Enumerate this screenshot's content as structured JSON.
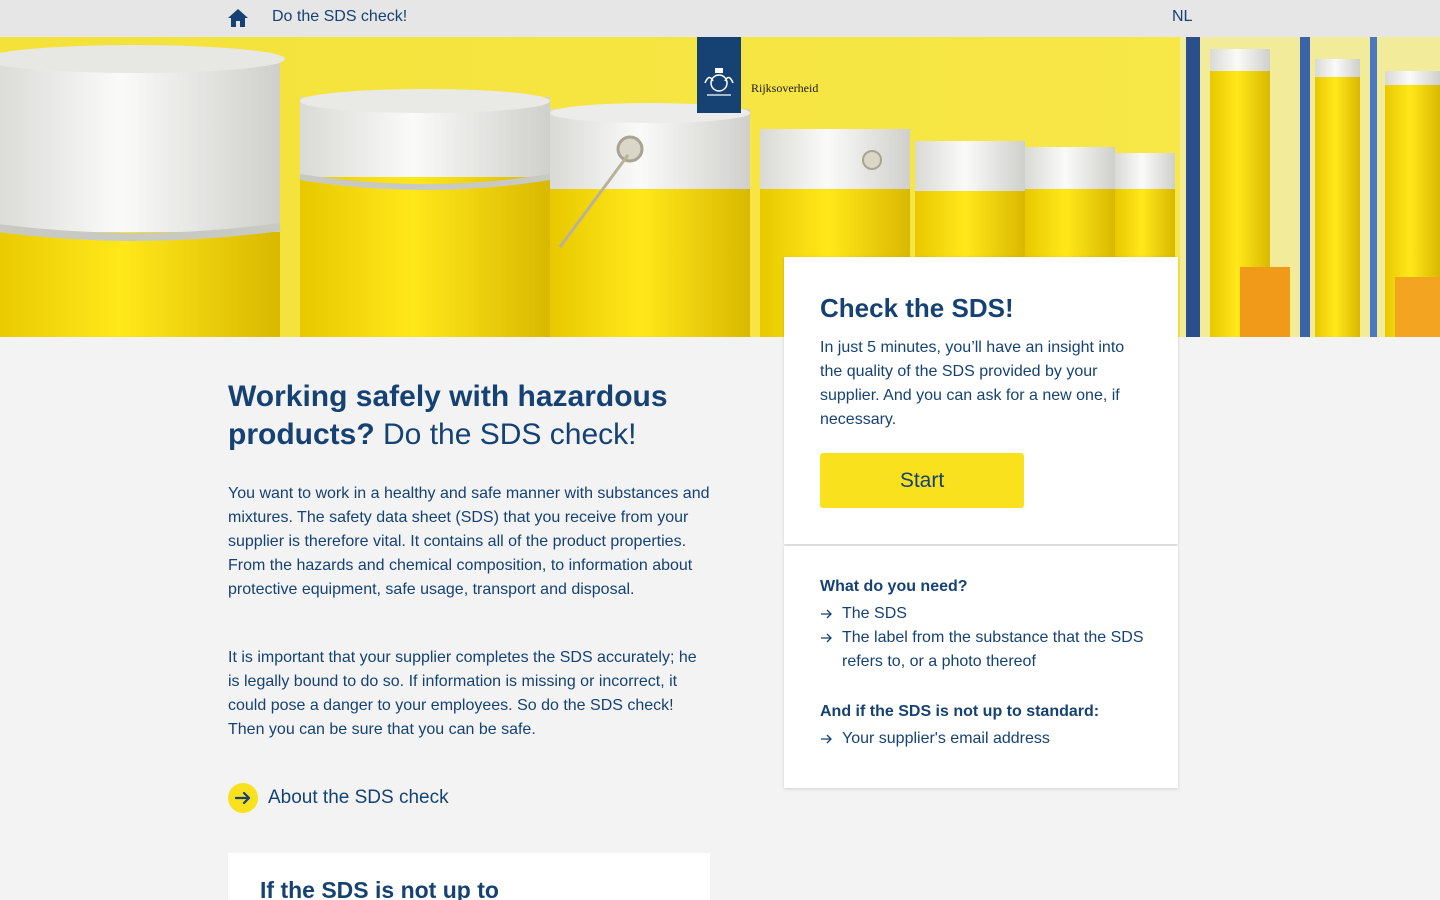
{
  "topbar": {
    "home_icon": "home-icon",
    "title": "Do the SDS check!",
    "language": "NL"
  },
  "logo": {
    "text": "Rijksoverheid"
  },
  "intro": {
    "title_strong": "Working safely with hazardous products?",
    "title_light": "Do the SDS check!",
    "paragraph1": "You want to work in a healthy and safe manner with substances and mixtures. The safety data sheet (SDS) that you receive from your supplier is therefore vital. It contains all of the product properties. From the hazards and chemical composition, to information about protective equipment, safe usage, transport and disposal.",
    "paragraph2": "It is important that your supplier completes the SDS accurately; he is legally bound to do so. If information is missing or incorrect, it could pose a danger to your employees. So do the SDS check! Then you can be sure that you can be safe.",
    "about_link": "About the SDS check"
  },
  "check_card": {
    "title": "Check the SDS!",
    "text": "In just 5 minutes, you’ll have an insight into the quality of the SDS provided by your supplier. And you can ask for a new one, if necessary.",
    "start_label": "Start"
  },
  "needs_card": {
    "heading_need": "What do you need?",
    "need_items": [
      "The SDS",
      "The label from the substance that the SDS refers to, or a photo thereof"
    ],
    "heading_standard": "And if the SDS is not up to standard:",
    "standard_items": [
      "Your supplier's email address"
    ]
  },
  "bottom_card": {
    "title": "If the SDS is not up to"
  },
  "colors": {
    "brand_blue": "#154273",
    "accent_yellow": "#f9e11e",
    "topbar_gray": "#e6e6e6",
    "page_background": "#f3f3f3"
  }
}
